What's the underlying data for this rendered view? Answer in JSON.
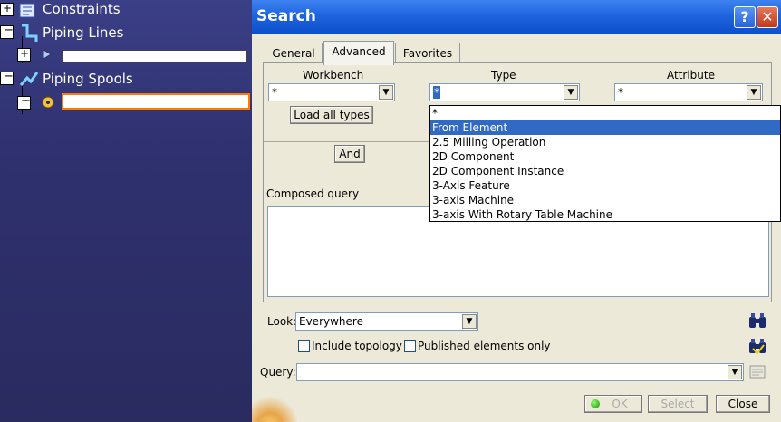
{
  "tree": {
    "items": [
      {
        "label": "Constraints"
      },
      {
        "label": "Piping Lines"
      },
      {
        "label": "Piping Spools"
      }
    ]
  },
  "dialog": {
    "title": "Search",
    "help_symbol": "?",
    "close_symbol": "✕",
    "tabs": [
      "General",
      "Advanced",
      "Favorites"
    ],
    "active_tab": "Advanced",
    "workbench": {
      "label": "Workbench",
      "value": "*"
    },
    "type": {
      "label": "Type",
      "value": "*"
    },
    "attribute": {
      "label": "Attribute",
      "value": "*"
    },
    "load_all_types": "Load all types",
    "and_button": "And",
    "composed_query_label": "Composed query",
    "type_options": [
      "*",
      "From Element",
      "2.5 Milling Operation",
      "2D Component",
      "2D Component Instance",
      "3-Axis Feature",
      "3-axis Machine",
      "3-axis With Rotary Table Machine"
    ],
    "selected_option": "From Element",
    "look_label": "Look:",
    "look_value": "Everywhere",
    "include_topology": "Include topology",
    "published_only": "Published elements only",
    "query_label": "Query:",
    "query_value": "",
    "ok": "OK",
    "select": "Select",
    "close": "Close"
  }
}
